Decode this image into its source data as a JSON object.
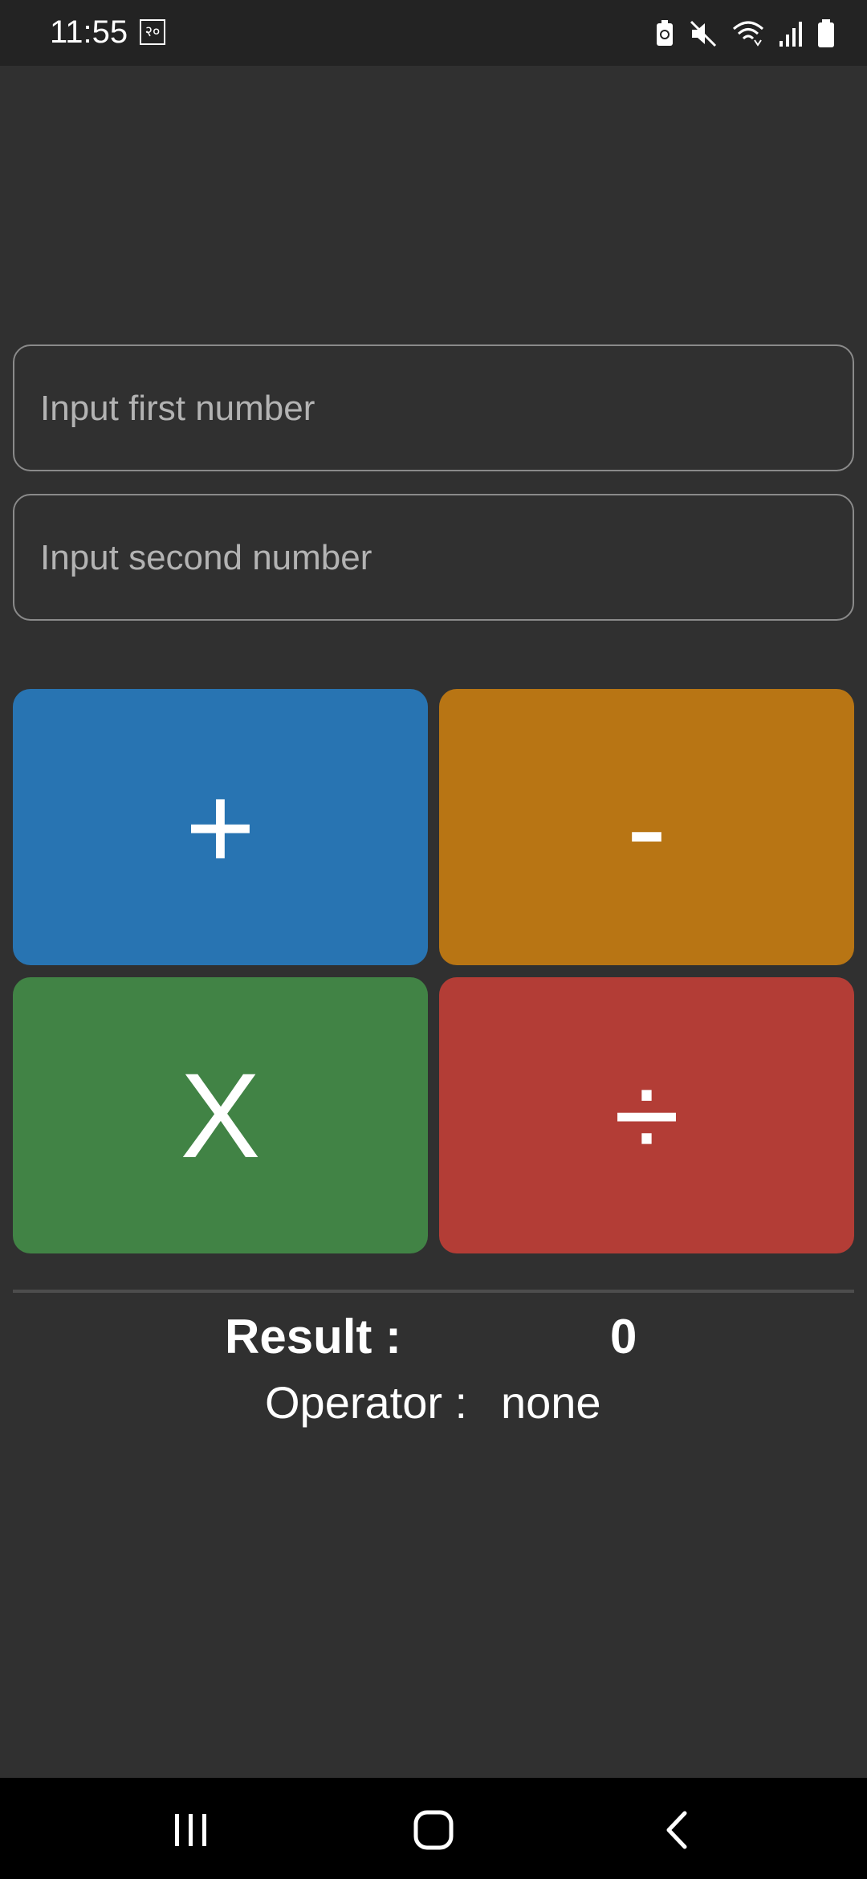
{
  "status_bar": {
    "time": "11:55",
    "badge": "२०",
    "icons": [
      "battery-saver-icon",
      "mute-icon",
      "wifi-icon",
      "signal-icon",
      "battery-icon"
    ]
  },
  "inputs": {
    "first_placeholder": "Input first number",
    "second_placeholder": "Input second number",
    "first_value": "",
    "second_value": ""
  },
  "operators": {
    "add": {
      "label": "+",
      "color": "#2874B2"
    },
    "subtract": {
      "label": "-",
      "color": "#B87514"
    },
    "multiply": {
      "label": "X",
      "color": "#418345"
    },
    "divide": {
      "label": "÷",
      "color": "#B33D36"
    }
  },
  "result": {
    "label": "Result :",
    "value": "0"
  },
  "operator_display": {
    "label": "Operator :",
    "value": "none"
  },
  "nav_bar": {
    "icons": [
      "recents-icon",
      "home-icon",
      "back-icon"
    ]
  }
}
